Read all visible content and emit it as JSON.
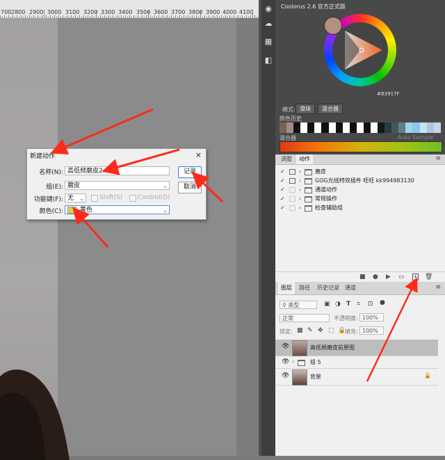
{
  "ruler": {
    "labels": [
      "700",
      "2800",
      "2900",
      "3000",
      "3100",
      "3200",
      "3300",
      "3400",
      "3500",
      "3600",
      "3700",
      "3800",
      "3900",
      "4000",
      "4100"
    ]
  },
  "dialog": {
    "title": "新建动作",
    "close": "×",
    "name_label": "名称(N):",
    "name_value": "高低频磨皮2",
    "set_label": "组(E):",
    "set_value": "磨皮",
    "fkey_label": "功能键(F):",
    "fkey_value": "无",
    "shift_label": "Shift(S)",
    "control_label": "Control(O)",
    "color_label": "颜色(C):",
    "color_value": "黄色",
    "record_button": "记录",
    "cancel_button": "取消"
  },
  "coolorus": {
    "title": "Coolorus 2.6 官方正式版",
    "hex": "#B3917F",
    "mode_label": "模式:",
    "slider_button": "滑块",
    "mixer_button": "混合器",
    "history_label": "颜色历史",
    "mixer_label": "混合器",
    "auto_sample": "Auto Sample",
    "colors": {
      "current": "#B3917F"
    },
    "history_colors": [
      "#7a6257",
      "#a08c85",
      "#111111",
      "#ffffff",
      "#111111",
      "#ffffff",
      "#111111",
      "#ffffff",
      "#111111",
      "#ffffff",
      "#111111",
      "#ffffff",
      "#111111",
      "#ffffff",
      "#0c1a1a",
      "#2b3a3a",
      "#3f5a5a",
      "#5e7f8f",
      "#9fd3e8",
      "#88c8ee",
      "#c7e2f2",
      "#b5c2e0",
      "#c9d2ec"
    ]
  },
  "actions": {
    "tabs": [
      "调整",
      "动作"
    ],
    "items": [
      {
        "label": "磨皮",
        "expanded": true
      },
      {
        "label": "GOG光线特效插件 旺旺 kk994983130",
        "expanded": false
      },
      {
        "label": "通道动作",
        "expanded": false
      },
      {
        "label": "常规操作",
        "expanded": false
      },
      {
        "label": "检查辅助组",
        "expanded": false
      }
    ]
  },
  "layers": {
    "tabs": [
      "图层",
      "路径",
      "历史记录",
      "通道"
    ],
    "kind_placeholder": "类型",
    "blend_mode": "正常",
    "opacity_label": "不透明度:",
    "opacity_value": "100%",
    "lock_label": "锁定:",
    "fill_label": "填充:",
    "fill_value": "100%",
    "items": [
      {
        "name": "高低频磨皮前原图",
        "type": "image",
        "selected": true
      },
      {
        "name": "组 5",
        "type": "group",
        "selected": false
      },
      {
        "name": "背景",
        "type": "image",
        "selected": false,
        "locked": true
      }
    ]
  }
}
